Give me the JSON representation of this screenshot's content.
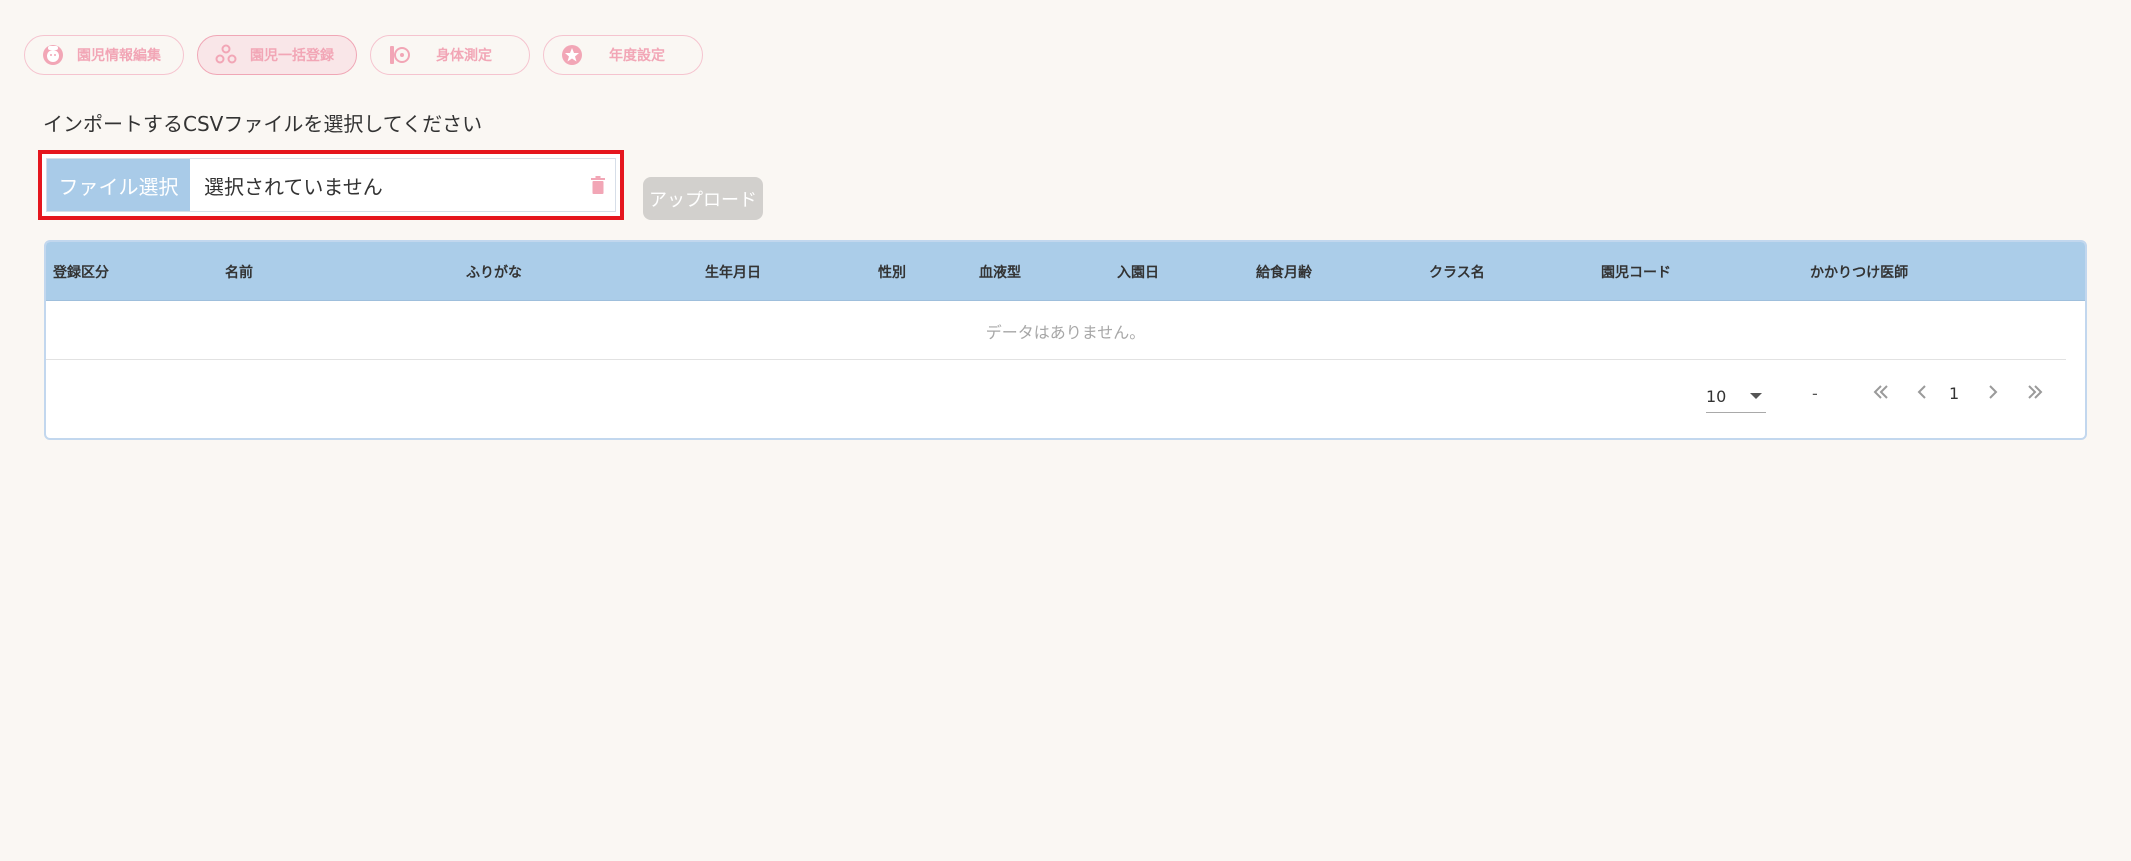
{
  "tabs": [
    {
      "label": "園児情報編集",
      "icon": "child-face-icon"
    },
    {
      "label": "園児一括登録",
      "icon": "group-icon"
    },
    {
      "label": "身体測定",
      "icon": "measure-icon"
    },
    {
      "label": "年度設定",
      "icon": "star-badge-icon"
    }
  ],
  "instruction": "インポートするCSVファイルを選択してください",
  "file_input": {
    "button_label": "ファイル選択",
    "value": "選択されていません"
  },
  "upload_label": "アップロード",
  "table": {
    "headers": [
      "登録区分",
      "名前",
      "ふりがな",
      "生年月日",
      "性別",
      "血液型",
      "入園日",
      "給食月齢",
      "クラス名",
      "園児コード",
      "かかりつけ医師"
    ],
    "empty_message": "データはありません。"
  },
  "pagination": {
    "per_page": "10",
    "range": "-",
    "page": "1"
  },
  "colors": {
    "accent_pink": "#f2a6b6",
    "header_blue": "#abcde9",
    "highlight_red": "#e5161e",
    "disabled_gray": "#d2d0cd"
  }
}
